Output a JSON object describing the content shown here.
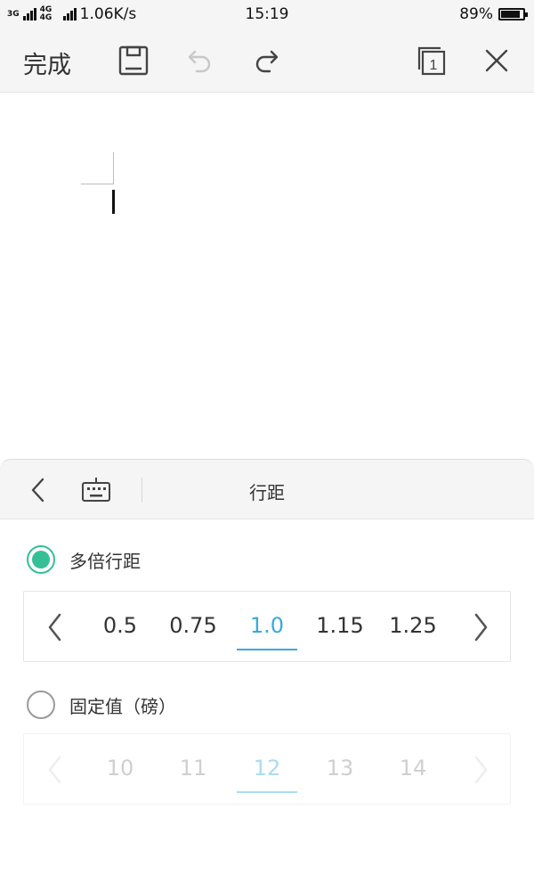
{
  "status": {
    "net_left": "3G",
    "net_right": "4G 4G",
    "speed": "1.06K/s",
    "time": "15:19",
    "battery": "89%",
    "battery_level": 0.89
  },
  "toolbar": {
    "done_label": "完成",
    "icons": [
      "save-icon",
      "undo-icon",
      "redo-icon",
      "page-count-icon",
      "close-icon"
    ],
    "page_count": "1"
  },
  "panel": {
    "title": "行距",
    "options": [
      {
        "label": "多倍行距",
        "selected": true,
        "values": [
          "0.5",
          "0.75",
          "1.0",
          "1.15",
          "1.25"
        ],
        "selected_value": "1.0"
      },
      {
        "label": "固定值（磅）",
        "selected": false,
        "values": [
          "10",
          "11",
          "12",
          "13",
          "14"
        ],
        "selected_value": "12"
      }
    ]
  },
  "colors": {
    "accent_green": "#35bf97",
    "accent_blue": "#3aa8df"
  }
}
